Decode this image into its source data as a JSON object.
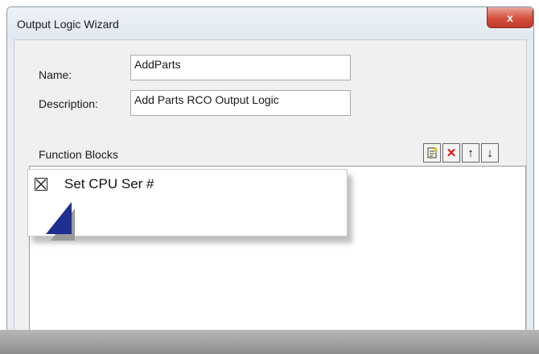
{
  "window": {
    "title": "Output Logic Wizard",
    "close_label": "x"
  },
  "form": {
    "name_label": "Name:",
    "name_value": "AddParts",
    "description_label": "Description:",
    "description_value": "Add Parts RCO Output Logic"
  },
  "function_blocks": {
    "label": "Function Blocks",
    "toolbar": {
      "new_icon": "new-document-icon",
      "delete_label": "✕",
      "move_up_label": "↑",
      "move_down_label": "↓"
    },
    "items": [
      {
        "label": "Set CPU Ser #",
        "checked": true
      }
    ]
  }
}
